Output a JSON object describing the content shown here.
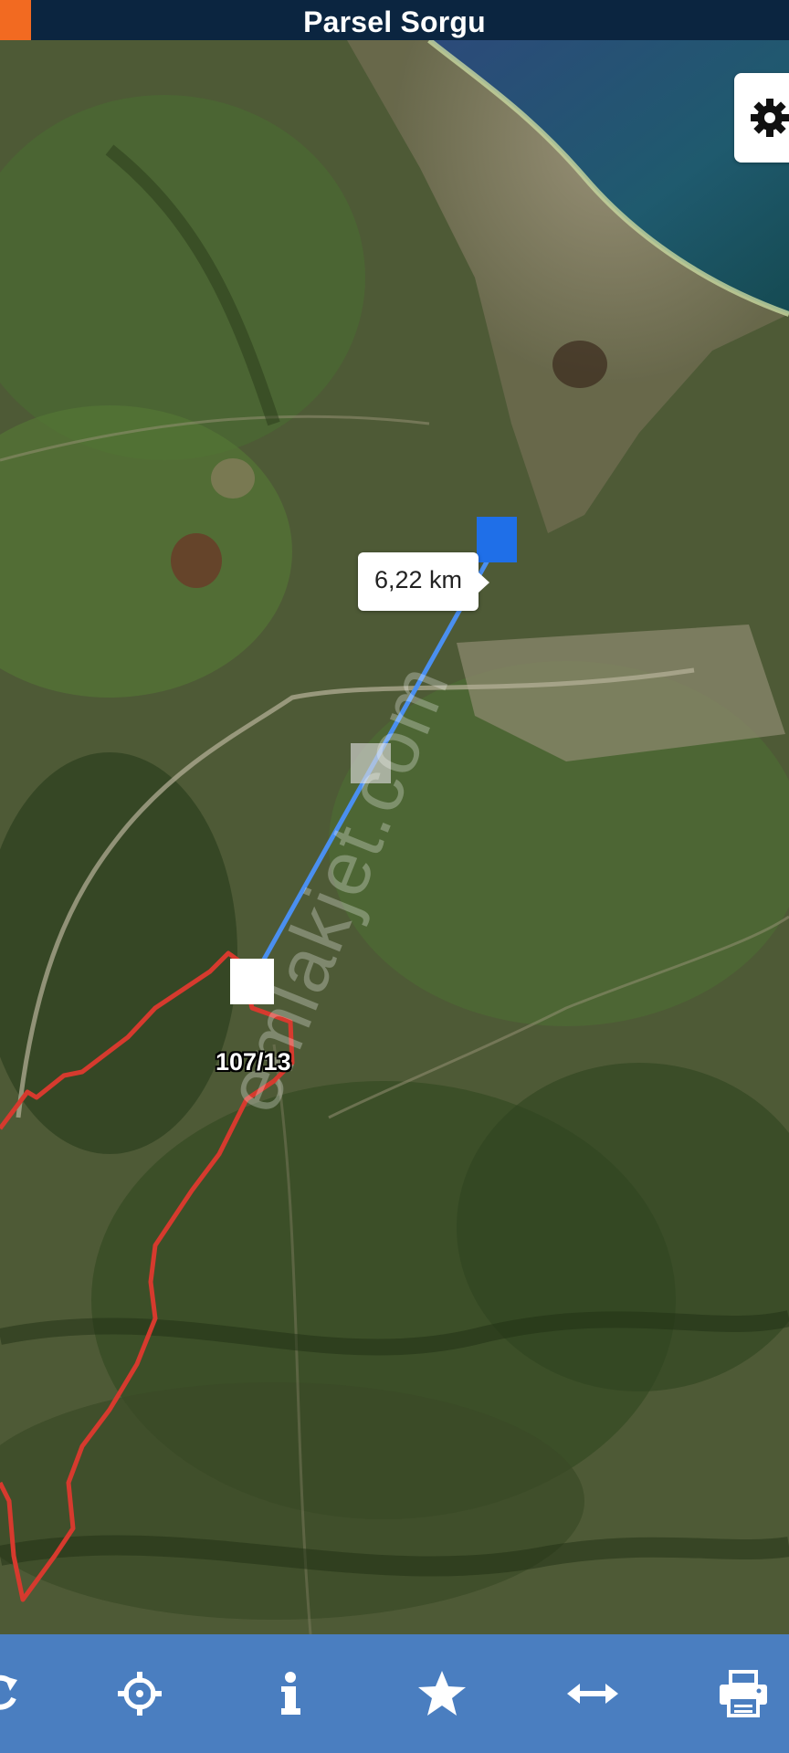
{
  "header": {
    "title": "Parsel Sorgu",
    "accent_color": "#f26a21",
    "bar_color": "#0b2540"
  },
  "map": {
    "type": "satellite",
    "measure_label": "6,22 km",
    "parcel_label": "107/13",
    "measure_line_color": "#4a8ff0",
    "boundary_color": "#d63a2e",
    "watermark": "emlakjet.com"
  },
  "settings": {
    "icon": "gear-icon"
  },
  "toolbar": {
    "buttons": [
      {
        "name": "refresh-button",
        "icon": "refresh-icon"
      },
      {
        "name": "locate-button",
        "icon": "crosshair-icon"
      },
      {
        "name": "info-button",
        "icon": "info-icon"
      },
      {
        "name": "favorite-button",
        "icon": "star-icon"
      },
      {
        "name": "measure-button",
        "icon": "double-arrow-icon"
      },
      {
        "name": "print-button",
        "icon": "printer-icon"
      }
    ],
    "bar_color": "#4a7ec0"
  }
}
